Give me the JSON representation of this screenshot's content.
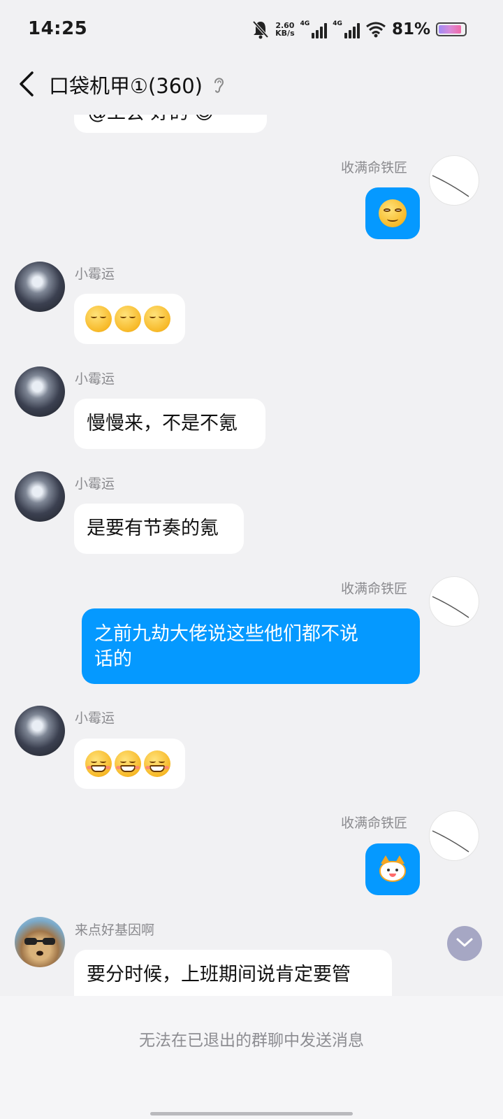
{
  "status_bar": {
    "time": "14:25",
    "net_speed_value": "2.60",
    "net_speed_unit": "KB/s",
    "net1": "4G",
    "net2": "4G",
    "battery_percent": "81%",
    "battery_level": 0.81,
    "icons": [
      "mute-bell-icon",
      "signal-icon",
      "signal-icon",
      "wifi-icon",
      "battery-icon"
    ]
  },
  "header": {
    "title": "口袋机甲①(360)",
    "icons": [
      "back-chevron-icon",
      "ear-icon"
    ]
  },
  "messages": [
    {
      "side": "other",
      "text": "@工会 好的 😊",
      "cut_off": true
    },
    {
      "side": "me",
      "name": "收满命铁匠",
      "emoji": "smirk-emoji"
    },
    {
      "side": "other",
      "name": "小霉运",
      "emoji": "pensive-emoji x3"
    },
    {
      "side": "other",
      "name": "小霉运",
      "text": "慢慢来，不是不氪"
    },
    {
      "side": "other",
      "name": "小霉运",
      "text": "是要有节奏的氪"
    },
    {
      "side": "me",
      "name": "收满命铁匠",
      "text_line1": "之前九劫大佬说这些他们都不说",
      "text_line2": "话的"
    },
    {
      "side": "other",
      "name": "小霉运",
      "emoji": "grin-emoji x3"
    },
    {
      "side": "me",
      "name": "收满命铁匠",
      "emoji": "cat-sticker"
    },
    {
      "side": "other",
      "name": "来点好基因啊",
      "text": "要分时候，上班期间说肯定要管",
      "cut_off": true
    }
  ],
  "footer": {
    "notice": "无法在已退出的群聊中发送消息"
  },
  "colors": {
    "background": "#f1f1f3",
    "my_bubble": "#0599ff",
    "other_bubble": "#ffffff",
    "name_text": "#8a8a8e",
    "scroll_button": "#a6a7c4"
  }
}
